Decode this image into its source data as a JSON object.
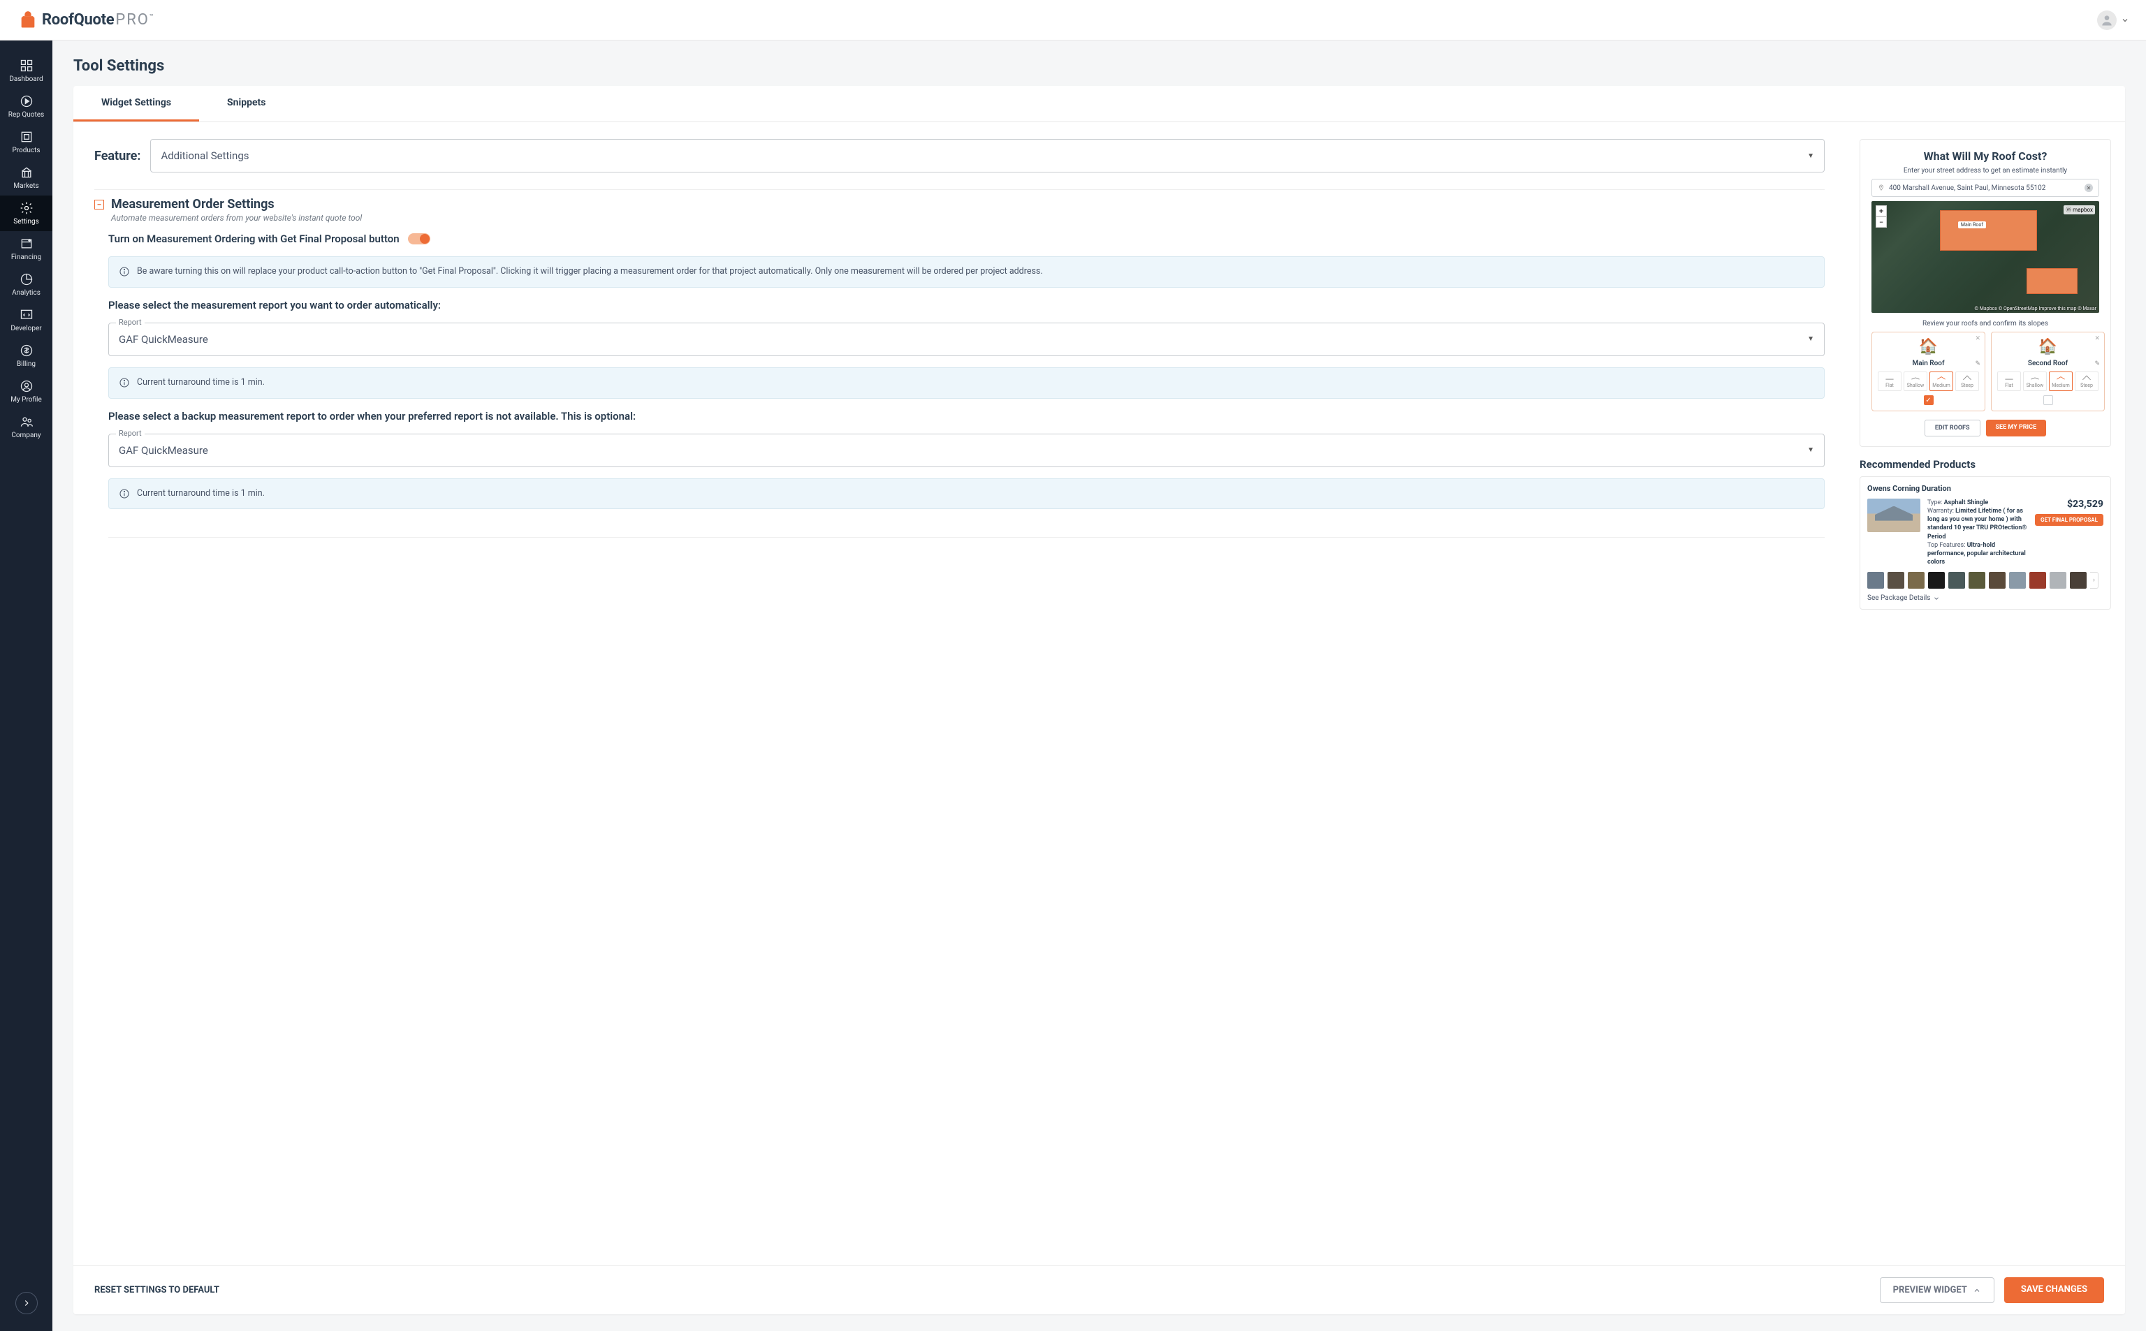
{
  "brand": {
    "name": "RoofQuote",
    "suffix": "PRO",
    "tm": "™"
  },
  "sidebar": {
    "items": [
      {
        "label": "Dashboard"
      },
      {
        "label": "Rep Quotes"
      },
      {
        "label": "Products"
      },
      {
        "label": "Markets"
      },
      {
        "label": "Settings"
      },
      {
        "label": "Financing"
      },
      {
        "label": "Analytics"
      },
      {
        "label": "Developer"
      },
      {
        "label": "Billing"
      },
      {
        "label": "My Profile"
      },
      {
        "label": "Company"
      }
    ]
  },
  "page": {
    "title": "Tool Settings"
  },
  "tabs": {
    "widget": "Widget Settings",
    "snippets": "Snippets"
  },
  "feature": {
    "label": "Feature:",
    "selected": "Additional Settings"
  },
  "section": {
    "title": "Measurement Order Settings",
    "subtitle": "Automate measurement orders from your website's instant quote tool"
  },
  "toggle": {
    "label": "Turn on Measurement Ordering with Get Final Proposal button"
  },
  "alert1": "Be aware turning this on will replace your product call-to-action button to \"Get Final Proposal\". Clicking it will trigger placing a measurement order for that project automatically. Only one measurement will be ordered per project address.",
  "reportPrimary": {
    "prompt": "Please select the measurement report you want to order automatically:",
    "legend": "Report",
    "value": "GAF QuickMeasure"
  },
  "turnaround1": "Current turnaround time is 1 min.",
  "reportBackup": {
    "prompt": "Please select a backup measurement report to order when your preferred report is not available. This is optional:",
    "legend": "Report",
    "value": "GAF QuickMeasure"
  },
  "turnaround2": "Current turnaround time is 1 min.",
  "footer": {
    "reset": "RESET SETTINGS TO DEFAULT",
    "preview": "PREVIEW WIDGET",
    "save": "SAVE CHANGES"
  },
  "widget": {
    "title": "What Will My Roof Cost?",
    "subtitle": "Enter your street address to get an estimate instantly",
    "address": "400 Marshall Avenue, Saint Paul, Minnesota 55102",
    "mapbox": "© Mapbox",
    "osm": "© OpenStreetMap",
    "improve": "Improve this map",
    "maxar": "© Maxar",
    "roofLabelMain": "Main Roof",
    "roofLabelSecond": "Second Roof",
    "review": "Review your roofs and confirm its slopes",
    "roofs": [
      {
        "name": "Main Roof",
        "checked": true
      },
      {
        "name": "Second Roof",
        "checked": false
      }
    ],
    "slopes": [
      "Flat",
      "Shallow",
      "Medium",
      "Steep"
    ],
    "editRoofs": "EDIT ROOFS",
    "seePrice": "SEE MY PRICE",
    "recommended": "Recommended Products",
    "product": {
      "name": "Owens Corning Duration",
      "typeLabel": "Type:",
      "type": "Asphalt Shingle",
      "warrantyLabel": "Warranty:",
      "warranty": "Limited Lifetime ( for as long as you own your home ) with standard 10 year TRU PROtection® Period",
      "topFeaturesLabel": "Top Features:",
      "topFeatures": "Ultra-hold performance, popular architectural colors",
      "price": "$23,529",
      "proposalBtn": "GET FINAL PROPOSAL",
      "swatches": [
        "#6a7a8a",
        "#5a5044",
        "#7a6a4a",
        "#1a1a1a",
        "#4a5a5a",
        "#5a5a3a",
        "#5a4a3a",
        "#8a9aa8",
        "#9a3a2a",
        "#b0b4b8",
        "#4a4038"
      ],
      "packageLink": "See Package Details"
    }
  }
}
